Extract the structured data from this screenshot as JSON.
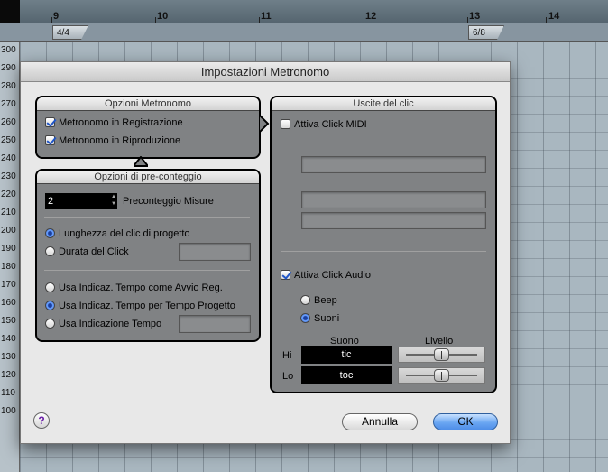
{
  "ruler": {
    "bars": [
      "9",
      "10",
      "11",
      "12",
      "13",
      "14"
    ]
  },
  "signatures": [
    "4/4",
    "6/8"
  ],
  "pitch_labels": [
    "300",
    "290",
    "280",
    "270",
    "260",
    "250",
    "240",
    "230",
    "220",
    "210",
    "200",
    "190",
    "180",
    "170",
    "160",
    "150",
    "140",
    "130",
    "120",
    "110",
    "100"
  ],
  "dialog": {
    "title": "Impostazioni Metronomo",
    "metronome_options": {
      "header": "Opzioni Metronomo",
      "record": {
        "label": "Metronomo in Registrazione",
        "checked": true
      },
      "playback": {
        "label": "Metronomo in Riproduzione",
        "checked": true
      }
    },
    "precount_options": {
      "header": "Opzioni di pre-conteggio",
      "bars_value": "2",
      "bars_label": "Preconteggio Misure",
      "project_click_length": {
        "label": "Lunghezza del clic di progetto",
        "checked": true
      },
      "click_duration": {
        "label": "Durata del Click",
        "checked": false
      },
      "use_tempo_start": {
        "label": "Usa Indicaz. Tempo come Avvio Reg.",
        "checked": false
      },
      "use_tempo_project": {
        "label": "Usa Indicaz. Tempo per Tempo Progetto",
        "checked": true
      },
      "use_tempo_indication": {
        "label": "Usa Indicazione Tempo",
        "checked": false
      }
    },
    "click_outputs": {
      "header": "Uscite del clic",
      "midi": {
        "label": "Attiva Click MIDI",
        "checked": false
      },
      "audio": {
        "label": "Attiva Click Audio",
        "checked": true
      },
      "beep": {
        "label": "Beep",
        "checked": false
      },
      "sounds": {
        "label": "Suoni",
        "checked": true
      },
      "col_sound": "Suono",
      "col_level": "Livello",
      "hi": {
        "label": "Hi",
        "sound": "tic",
        "level": 0.5
      },
      "lo": {
        "label": "Lo",
        "sound": "toc",
        "level": 0.5
      }
    },
    "help_label": "?",
    "cancel_label": "Annulla",
    "ok_label": "OK"
  },
  "colors": {
    "accent": "#4f8ee8",
    "panel": "#808284",
    "checkmark": "#1f55c7"
  }
}
